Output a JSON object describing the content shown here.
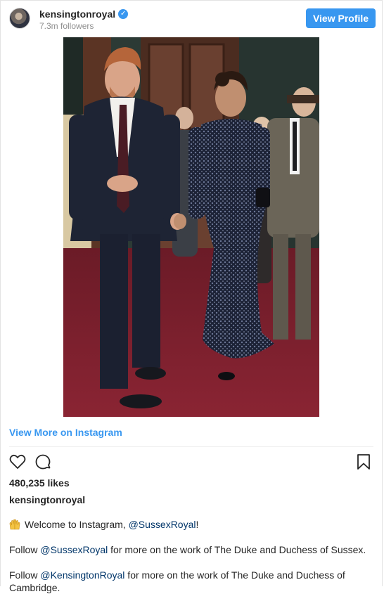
{
  "header": {
    "username": "kensingtonroyal",
    "followers": "7.3m followers",
    "view_profile_label": "View Profile",
    "verified_icon": "verified-badge-icon"
  },
  "footer": {
    "view_more_label": "View More on Instagram",
    "likes": "480,235 likes",
    "caption_username": "kensingtonroyal"
  },
  "caption": {
    "line1_text": "Welcome to Instagram, ",
    "line1_mention": "@SussexRoyal",
    "line1_end": "!",
    "line2_start": "Follow ",
    "line2_mention": "@SussexRoyal",
    "line2_end": " for more on the work of The Duke and Duchess of Sussex.",
    "line3_start": "Follow ",
    "line3_mention": "@KensingtonRoyal",
    "line3_end": " for more on the work of The Duke and Duchess of",
    "line4_text": "Cambridge."
  },
  "colors": {
    "accent": "#3897f0",
    "mention": "#003569",
    "carpet": "#7a1f2b",
    "wall": "#2c3a35"
  },
  "icons": [
    "heart-icon",
    "comment-icon",
    "bookmark-icon",
    "raising-hands-emoji"
  ]
}
